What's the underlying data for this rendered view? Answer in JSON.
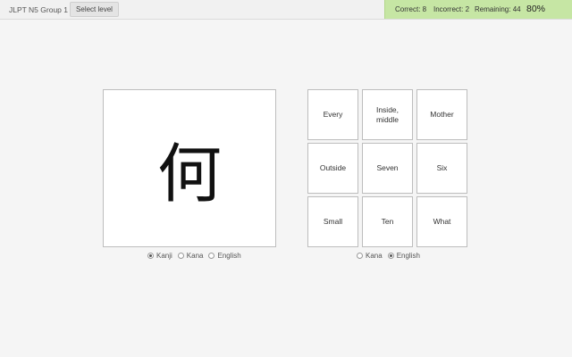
{
  "header": {
    "title": "JLPT N5 Group 1",
    "select_level_label": "Select level"
  },
  "stats": {
    "correct": "Correct: 8",
    "incorrect": "Incorrect: 2",
    "remaining": "Remaining: 44",
    "percent": "80%",
    "background_color": "#c6e6a4"
  },
  "question": {
    "kanji": "何"
  },
  "question_display": {
    "options": [
      "Kanji",
      "Kana",
      "English"
    ],
    "selected": "Kanji"
  },
  "answers": {
    "choices": [
      "Every",
      "Inside, middle",
      "Mother",
      "Outside",
      "Seven",
      "Six",
      "Small",
      "Ten",
      "What"
    ]
  },
  "answer_display": {
    "options": [
      "Kana",
      "English"
    ],
    "selected": "English"
  }
}
